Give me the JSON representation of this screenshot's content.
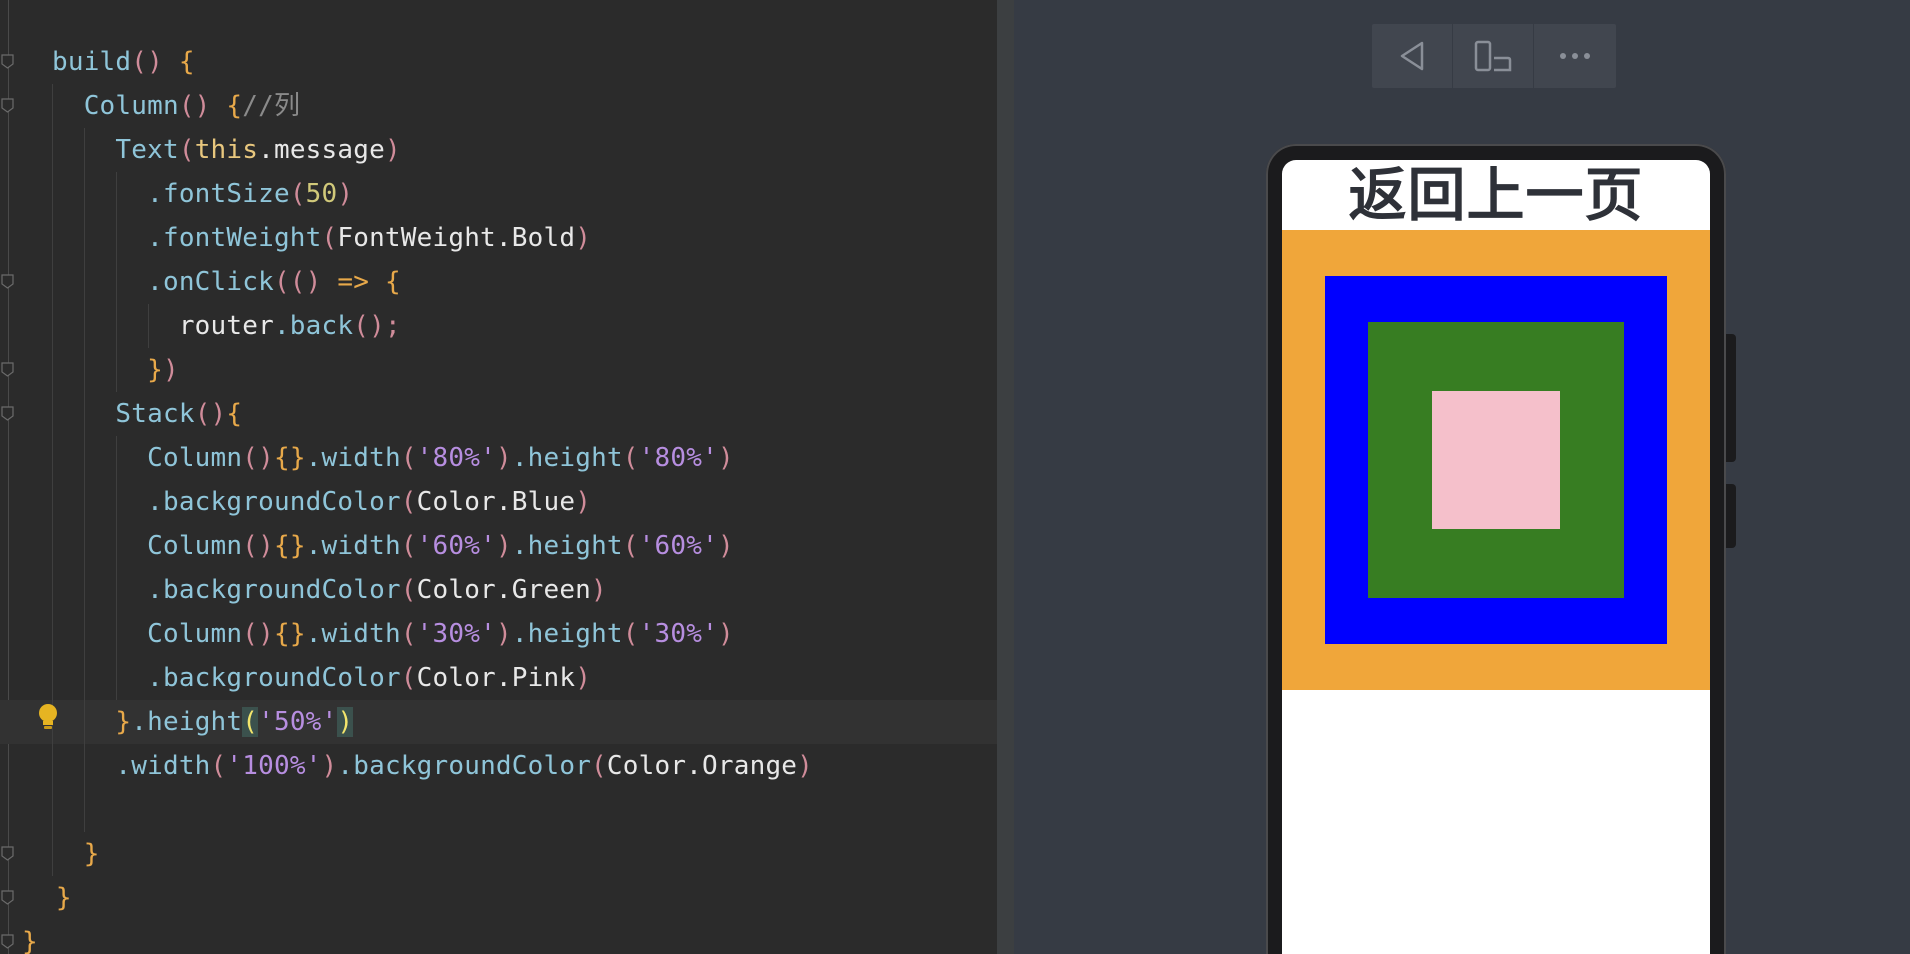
{
  "editor": {
    "lines": [
      [
        {
          "t": "build",
          "c": "tok-fn"
        },
        {
          "t": "()",
          "c": "tok-paren"
        },
        {
          "t": " ",
          "c": "tok-plain"
        },
        {
          "t": "{",
          "c": "tok-brace"
        }
      ],
      [
        {
          "t": "  Column",
          "c": "tok-fn"
        },
        {
          "t": "()",
          "c": "tok-paren"
        },
        {
          "t": " ",
          "c": "tok-plain"
        },
        {
          "t": "{",
          "c": "tok-brace"
        },
        {
          "t": "//列",
          "c": "tok-comment"
        }
      ],
      [
        {
          "t": "    Text",
          "c": "tok-fn"
        },
        {
          "t": "(",
          "c": "tok-paren"
        },
        {
          "t": "this",
          "c": "tok-kw"
        },
        {
          "t": ".message",
          "c": "tok-plain"
        },
        {
          "t": ")",
          "c": "tok-paren"
        }
      ],
      [
        {
          "t": "      .fontSize",
          "c": "tok-fn"
        },
        {
          "t": "(",
          "c": "tok-paren"
        },
        {
          "t": "50",
          "c": "tok-num"
        },
        {
          "t": ")",
          "c": "tok-paren"
        }
      ],
      [
        {
          "t": "      .fontWeight",
          "c": "tok-fn"
        },
        {
          "t": "(",
          "c": "tok-paren"
        },
        {
          "t": "FontWeight.Bold",
          "c": "tok-plain"
        },
        {
          "t": ")",
          "c": "tok-paren"
        }
      ],
      [
        {
          "t": "      .onClick",
          "c": "tok-fn"
        },
        {
          "t": "((",
          "c": "tok-paren"
        },
        {
          "t": ")",
          "c": "tok-paren"
        },
        {
          "t": " => ",
          "c": "tok-op"
        },
        {
          "t": "{",
          "c": "tok-brace"
        }
      ],
      [
        {
          "t": "        router",
          "c": "tok-plain"
        },
        {
          "t": ".back",
          "c": "tok-fn"
        },
        {
          "t": "();",
          "c": "tok-paren"
        }
      ],
      [
        {
          "t": "      }",
          "c": "tok-brace"
        },
        {
          "t": ")",
          "c": "tok-paren"
        }
      ],
      [
        {
          "t": "    Stack",
          "c": "tok-fn"
        },
        {
          "t": "()",
          "c": "tok-paren"
        },
        {
          "t": "{",
          "c": "tok-brace"
        }
      ],
      [
        {
          "t": "      Column",
          "c": "tok-fn"
        },
        {
          "t": "()",
          "c": "tok-paren"
        },
        {
          "t": "{}",
          "c": "tok-brace"
        },
        {
          "t": ".width",
          "c": "tok-fn"
        },
        {
          "t": "(",
          "c": "tok-paren"
        },
        {
          "t": "'80%'",
          "c": "tok-str"
        },
        {
          "t": ")",
          "c": "tok-paren"
        },
        {
          "t": ".height",
          "c": "tok-fn"
        },
        {
          "t": "(",
          "c": "tok-paren"
        },
        {
          "t": "'80%'",
          "c": "tok-str"
        },
        {
          "t": ")",
          "c": "tok-paren"
        }
      ],
      [
        {
          "t": "      .backgroundColor",
          "c": "tok-fn"
        },
        {
          "t": "(",
          "c": "tok-paren"
        },
        {
          "t": "Color.Blue",
          "c": "tok-plain"
        },
        {
          "t": ")",
          "c": "tok-paren"
        }
      ],
      [
        {
          "t": "      Column",
          "c": "tok-fn"
        },
        {
          "t": "()",
          "c": "tok-paren"
        },
        {
          "t": "{}",
          "c": "tok-brace"
        },
        {
          "t": ".width",
          "c": "tok-fn"
        },
        {
          "t": "(",
          "c": "tok-paren"
        },
        {
          "t": "'60%'",
          "c": "tok-str"
        },
        {
          "t": ")",
          "c": "tok-paren"
        },
        {
          "t": ".height",
          "c": "tok-fn"
        },
        {
          "t": "(",
          "c": "tok-paren"
        },
        {
          "t": "'60%'",
          "c": "tok-str"
        },
        {
          "t": ")",
          "c": "tok-paren"
        }
      ],
      [
        {
          "t": "      .backgroundColor",
          "c": "tok-fn"
        },
        {
          "t": "(",
          "c": "tok-paren"
        },
        {
          "t": "Color.Green",
          "c": "tok-plain"
        },
        {
          "t": ")",
          "c": "tok-paren"
        }
      ],
      [
        {
          "t": "      Column",
          "c": "tok-fn"
        },
        {
          "t": "()",
          "c": "tok-paren"
        },
        {
          "t": "{}",
          "c": "tok-brace"
        },
        {
          "t": ".width",
          "c": "tok-fn"
        },
        {
          "t": "(",
          "c": "tok-paren"
        },
        {
          "t": "'30%'",
          "c": "tok-str"
        },
        {
          "t": ")",
          "c": "tok-paren"
        },
        {
          "t": ".height",
          "c": "tok-fn"
        },
        {
          "t": "(",
          "c": "tok-paren"
        },
        {
          "t": "'30%'",
          "c": "tok-str"
        },
        {
          "t": ")",
          "c": "tok-paren"
        }
      ],
      [
        {
          "t": "      .backgroundColor",
          "c": "tok-fn"
        },
        {
          "t": "(",
          "c": "tok-paren"
        },
        {
          "t": "Color.Pink",
          "c": "tok-plain"
        },
        {
          "t": ")",
          "c": "tok-paren"
        }
      ],
      [
        {
          "t": "    }",
          "c": "tok-brace"
        },
        {
          "t": ".height",
          "c": "tok-fn"
        },
        {
          "t": "(",
          "c": "tok-yellowparen tok-match"
        },
        {
          "t": "'50%'",
          "c": "tok-str"
        },
        {
          "t": ")",
          "c": "tok-yellowparen tok-match"
        }
      ],
      [
        {
          "t": "    .width",
          "c": "tok-fn"
        },
        {
          "t": "(",
          "c": "tok-paren"
        },
        {
          "t": "'100%'",
          "c": "tok-str"
        },
        {
          "t": ")",
          "c": "tok-paren"
        },
        {
          "t": ".backgroundColor",
          "c": "tok-fn"
        },
        {
          "t": "(",
          "c": "tok-paren"
        },
        {
          "t": "Color.Orange",
          "c": "tok-plain"
        },
        {
          "t": ")",
          "c": "tok-paren"
        }
      ],
      [
        {
          "t": "",
          "c": "tok-plain"
        }
      ],
      [
        {
          "t": "  }",
          "c": "tok-brace"
        }
      ],
      [
        {
          "t": " }",
          "c": "tok-brace"
        }
      ],
      [
        {
          "t": "}",
          "c": "tok-brace"
        }
      ]
    ],
    "current_line_index": 15
  },
  "previewer": {
    "toolbar": {
      "buttons": [
        {
          "name": "back-icon"
        },
        {
          "name": "device-rotate-icon"
        },
        {
          "name": "more-icon"
        }
      ]
    },
    "screen": {
      "title": "返回上一页",
      "background": "#ffffff",
      "stack": {
        "height_fraction": 0.5,
        "background": "#f0a63a",
        "layers": [
          {
            "name": "blue-column",
            "color": "#0000ff",
            "size_fraction": 0.8
          },
          {
            "name": "green-column",
            "color": "#377d22",
            "size_fraction": 0.6
          },
          {
            "name": "pink-column",
            "color": "#f5c0cb",
            "size_fraction": 0.3
          }
        ]
      }
    }
  }
}
